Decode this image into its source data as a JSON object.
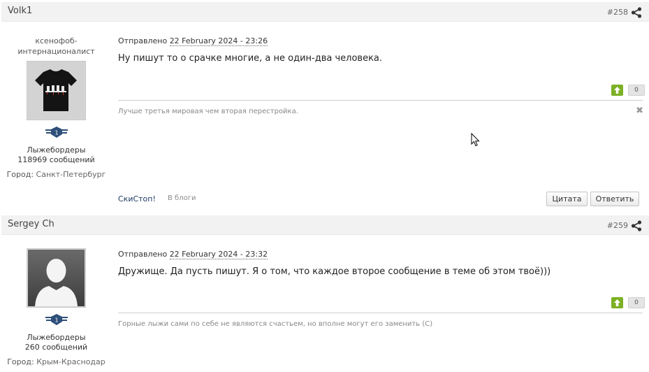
{
  "posts": [
    {
      "author": "Volk1",
      "number": "#258",
      "user_title": "ксенофоб-интернационалист",
      "rank": "1",
      "group": "Лыжебордеры",
      "post_count": "118969 сообщений",
      "city_label": "Город:",
      "city": "Санкт-Петербург",
      "sent_label": "Отправлено",
      "date": "22 February 2024 - 23:26",
      "content": "Ну пишут то о срачке многие, а не один-два человека.",
      "reputation": "0",
      "signature": "Лучше третья мировая чем вторая перестройка.",
      "footer_link": "СкиСтоп!",
      "blog_link": "В блоги",
      "quote_label": "Цитата",
      "reply_label": "Ответить"
    },
    {
      "author": "Sergey Ch",
      "number": "#259",
      "rank": "1",
      "group": "Лыжебордеры",
      "post_count": "260 сообщений",
      "city_label": "Город:",
      "city": "Крым-Краснодар",
      "sent_label": "Отправлено",
      "date": "22 February 2024 - 23:32",
      "content": "Дружище. Да пусть пишут. Я о том, что каждое второе сообщение в теме об этом твоё)))",
      "reputation": "0",
      "signature": "Горные лыжи сами по себе не являются счастьем, но вполне могут его заменить (С)"
    }
  ],
  "colors": {
    "vote_up": "#7cb025",
    "header_bg": "#f2f2f2"
  },
  "icons": [
    "share-icon",
    "arrow-up-icon",
    "close-icon",
    "rank-badge-icon",
    "mouse-cursor-icon"
  ]
}
